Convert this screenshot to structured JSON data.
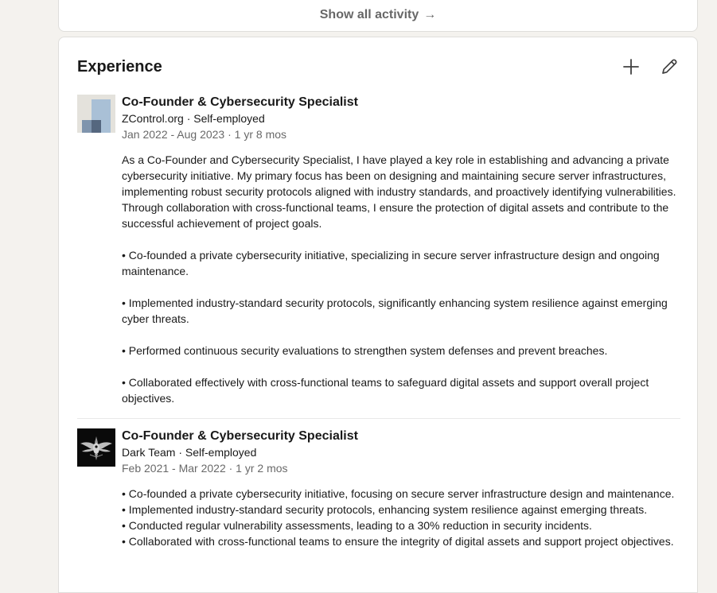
{
  "activity": {
    "show_all_label": "Show all activity",
    "arrow": "→"
  },
  "experience": {
    "title": "Experience",
    "add_icon": "plus-icon",
    "edit_icon": "pencil-icon",
    "entries": [
      {
        "title": "Co-Founder & Cybersecurity Specialist",
        "company": "ZControl.org · Self-employed",
        "dates": "Jan 2022 - Aug 2023 · 1 yr 8 mos",
        "logo": "zcontrol-logo",
        "paragraphs": [
          "As a Co-Founder and Cybersecurity Specialist, I have played a key role in establishing and advancing a private cybersecurity initiative. My primary focus has been on designing and maintaining secure server infrastructures, implementing robust security protocols aligned with industry standards, and proactively identifying vulnerabilities. Through collaboration with cross-functional teams, I ensure the protection of digital assets and contribute to the successful achievement of project goals.",
          "• Co-founded a private cybersecurity initiative, specializing in secure server infrastructure design and ongoing maintenance.",
          "• Implemented industry-standard security protocols, significantly enhancing system resilience against emerging cyber threats.",
          "• Performed continuous security evaluations to strengthen system defenses and prevent breaches.",
          "• Collaborated effectively with cross-functional teams to safeguard digital assets and support overall project objectives."
        ]
      },
      {
        "title": "Co-Founder & Cybersecurity Specialist",
        "company": "Dark Team · Self-employed",
        "dates": "Feb 2021 - Mar 2022 · 1 yr 2 mos",
        "logo": "dark-team-logo",
        "lines": [
          "• Co-founded a private cybersecurity initiative, focusing on secure server infrastructure design and maintenance.",
          "• Implemented industry-standard security protocols, enhancing system resilience against emerging threats.",
          "• Conducted regular vulnerability assessments, leading to a 30% reduction in security incidents.",
          "• Collaborated with cross-functional teams to ensure the integrity of digital assets and support project objectives."
        ]
      }
    ]
  }
}
